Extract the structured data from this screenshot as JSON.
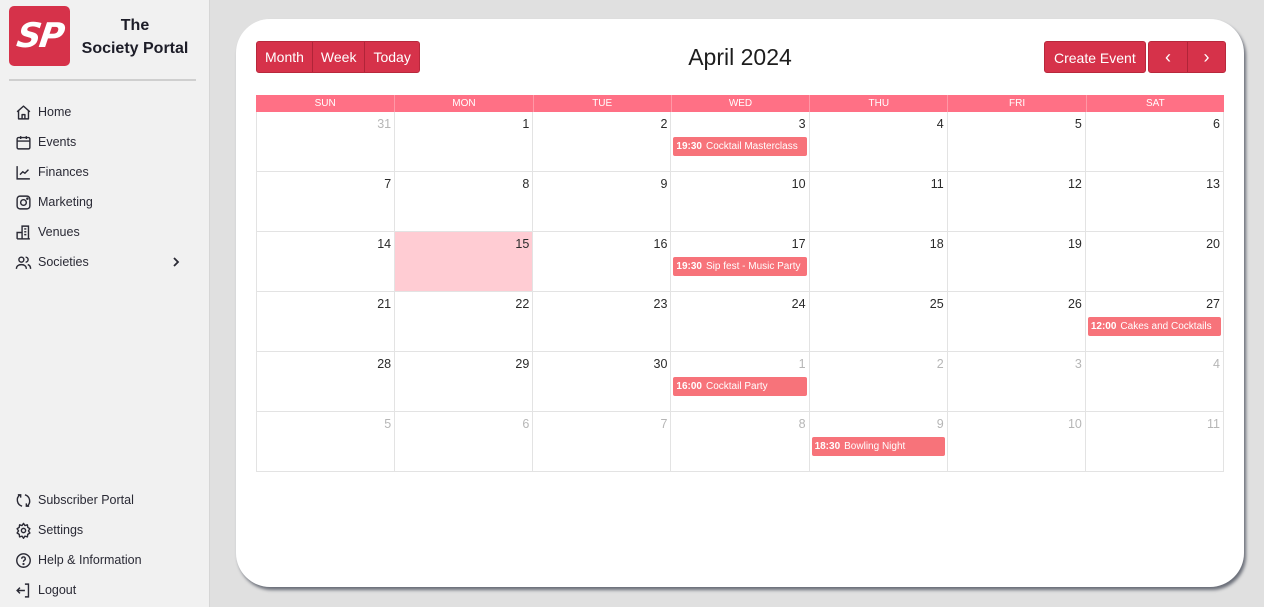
{
  "brand": {
    "logo_text": "SP",
    "title_line1": "The",
    "title_line2": "Society Portal",
    "accent": "#d6324a"
  },
  "sidebar": {
    "top_items": [
      {
        "label": "Home",
        "icon": "home-icon"
      },
      {
        "label": "Events",
        "icon": "calendar-icon"
      },
      {
        "label": "Finances",
        "icon": "chart-line-icon"
      },
      {
        "label": "Marketing",
        "icon": "instagram-icon"
      },
      {
        "label": "Venues",
        "icon": "building-icon"
      },
      {
        "label": "Societies",
        "icon": "users-icon",
        "has_submenu": true
      }
    ],
    "bottom_items": [
      {
        "label": "Subscriber Portal",
        "icon": "refresh-icon"
      },
      {
        "label": "Settings",
        "icon": "gear-icon"
      },
      {
        "label": "Help & Information",
        "icon": "help-circle-icon"
      },
      {
        "label": "Logout",
        "icon": "logout-icon"
      }
    ]
  },
  "toolbar": {
    "month_label": "Month",
    "week_label": "Week",
    "today_label": "Today",
    "title": "April 2024",
    "create_label": "Create Event",
    "prev_label": "‹",
    "next_label": "›"
  },
  "calendar": {
    "days_of_week": [
      "SUN",
      "MON",
      "TUE",
      "WED",
      "THU",
      "FRI",
      "SAT"
    ],
    "today": "15",
    "weeks": [
      [
        {
          "d": "31",
          "other": true
        },
        {
          "d": "1"
        },
        {
          "d": "2"
        },
        {
          "d": "3",
          "event": {
            "time": "19:30",
            "title": "Cocktail Masterclass"
          }
        },
        {
          "d": "4"
        },
        {
          "d": "5"
        },
        {
          "d": "6"
        }
      ],
      [
        {
          "d": "7"
        },
        {
          "d": "8"
        },
        {
          "d": "9"
        },
        {
          "d": "10"
        },
        {
          "d": "11"
        },
        {
          "d": "12"
        },
        {
          "d": "13"
        }
      ],
      [
        {
          "d": "14"
        },
        {
          "d": "15",
          "today": true
        },
        {
          "d": "16"
        },
        {
          "d": "17",
          "event": {
            "time": "19:30",
            "title": "Sip fest - Music Party"
          }
        },
        {
          "d": "18"
        },
        {
          "d": "19"
        },
        {
          "d": "20"
        }
      ],
      [
        {
          "d": "21"
        },
        {
          "d": "22"
        },
        {
          "d": "23"
        },
        {
          "d": "24"
        },
        {
          "d": "25"
        },
        {
          "d": "26"
        },
        {
          "d": "27",
          "event": {
            "time": "12:00",
            "title": "Cakes and Cocktails"
          }
        }
      ],
      [
        {
          "d": "28"
        },
        {
          "d": "29"
        },
        {
          "d": "30"
        },
        {
          "d": "1",
          "other": true,
          "event": {
            "time": "16:00",
            "title": "Cocktail Party"
          }
        },
        {
          "d": "2",
          "other": true
        },
        {
          "d": "3",
          "other": true
        },
        {
          "d": "4",
          "other": true
        }
      ],
      [
        {
          "d": "5",
          "other": true
        },
        {
          "d": "6",
          "other": true
        },
        {
          "d": "7",
          "other": true
        },
        {
          "d": "8",
          "other": true
        },
        {
          "d": "9",
          "other": true,
          "event": {
            "time": "18:30",
            "title": "Bowling Night"
          }
        },
        {
          "d": "10",
          "other": true
        },
        {
          "d": "11",
          "other": true
        }
      ]
    ]
  }
}
